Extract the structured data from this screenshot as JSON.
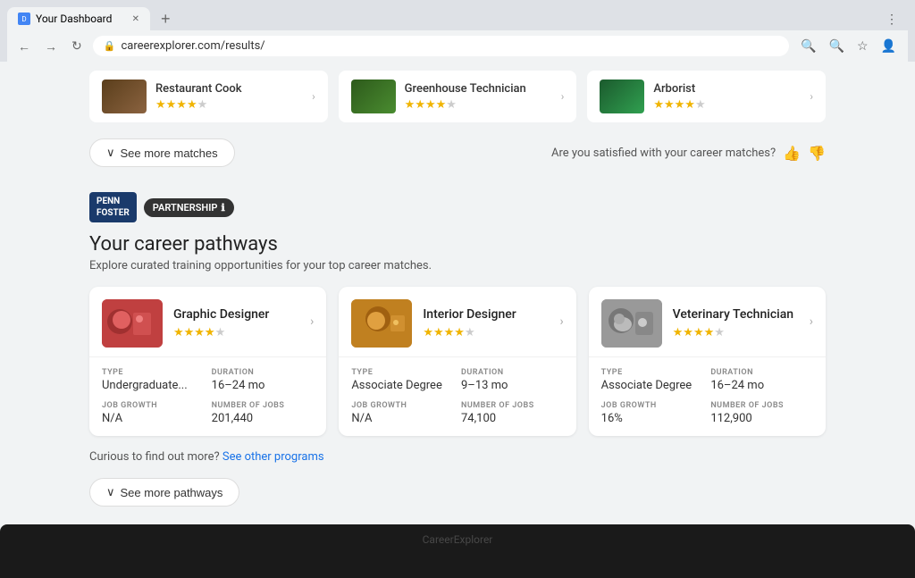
{
  "browser": {
    "tab_title": "Your Dashboard",
    "tab_favicon": "D",
    "url": "careerexplorer.com/results/",
    "new_tab_label": "+",
    "nav": {
      "back": "←",
      "forward": "→",
      "reload": "↻"
    }
  },
  "top_matches": {
    "items": [
      {
        "title": "Restaurant Cook",
        "stars": 4,
        "total": 5
      },
      {
        "title": "Greenhouse Technician",
        "stars": 4,
        "total": 5
      },
      {
        "title": "Arborist",
        "stars": 4,
        "total": 5
      }
    ],
    "see_more_label": "See more matches",
    "satisfaction_text": "Are you satisfied with your career matches?"
  },
  "partnership": {
    "logo_line1": "PENN",
    "logo_line2": "FOSTER",
    "badge_label": "PARTNERSHIP",
    "badge_icon": "ℹ"
  },
  "career_pathways": {
    "title": "Your career pathways",
    "subtitle": "Explore curated training opportunities for your top career matches.",
    "cards": [
      {
        "id": "graphic-designer",
        "title": "Graphic Designer",
        "stars": 3.5,
        "total": 5,
        "type_label": "TYPE",
        "type_value": "Undergraduate...",
        "duration_label": "DURATION",
        "duration_value": "16–24 mo",
        "job_growth_label": "JOB GROWTH",
        "job_growth_value": "N/A",
        "jobs_label": "NUMBER OF JOBS",
        "jobs_value": "201,440"
      },
      {
        "id": "interior-designer",
        "title": "Interior Designer",
        "stars": 3.5,
        "total": 5,
        "type_label": "TYPE",
        "type_value": "Associate Degree",
        "duration_label": "DURATION",
        "duration_value": "9–13 mo",
        "job_growth_label": "JOB GROWTH",
        "job_growth_value": "N/A",
        "jobs_label": "NUMBER OF JOBS",
        "jobs_value": "74,100"
      },
      {
        "id": "vet-technician",
        "title": "Veterinary Technician",
        "stars": 3.5,
        "total": 5,
        "type_label": "TYPE",
        "type_value": "Associate Degree",
        "duration_label": "DURATION",
        "duration_value": "16–24 mo",
        "job_growth_label": "JOB GROWTH",
        "job_growth_value": "16%",
        "jobs_label": "NUMBER OF JOBS",
        "jobs_value": "112,900"
      }
    ],
    "find_out_more_text": "Curious to find out more?",
    "find_out_more_link": "See other programs",
    "see_more_label": "See more pathways"
  }
}
